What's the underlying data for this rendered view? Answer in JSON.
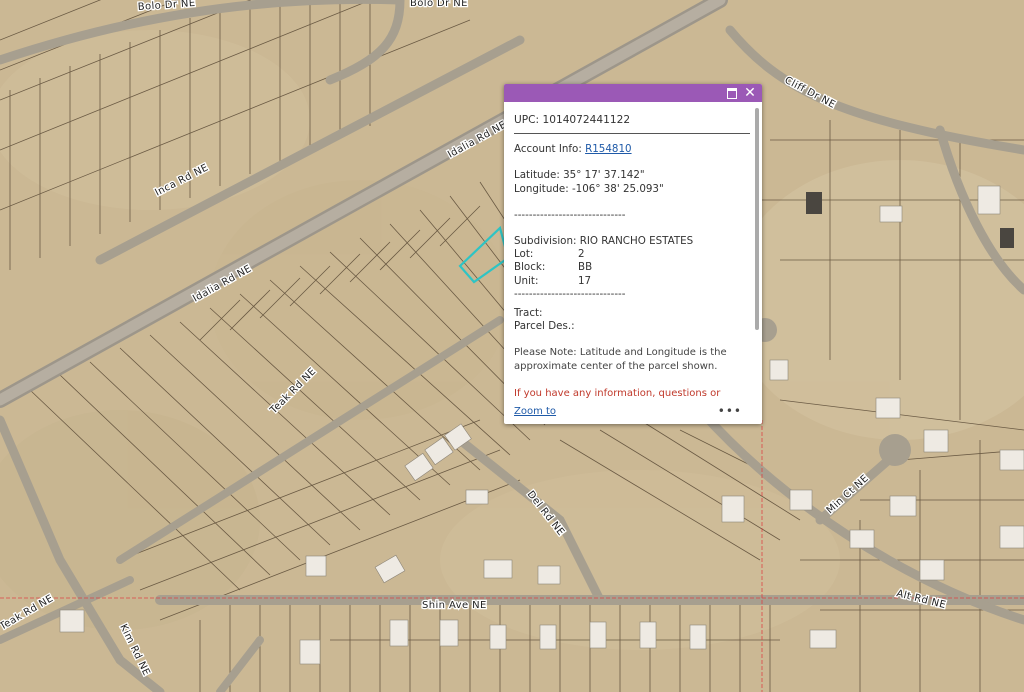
{
  "roads": {
    "bolo_dr_1": "Bolo Dr NE",
    "bolo_dr_2": "Bolo Dr NE",
    "inca_rd": "Inca Rd NE",
    "idalia_rd_upper": "Idalia Rd NE",
    "idalia_rd_lower": "Idalia Rd NE",
    "teak_rd_mid": "Teak Rd NE",
    "teak_rd_low": "Teak Rd NE",
    "cliff_dr": "Cliff Dr NE",
    "del_rd": "Del Rd NE",
    "min_ct": "Min Ct NE",
    "alt_rd": "Alt Rd NE",
    "shin_ave": "Shin Ave NE",
    "kim_rd": "Kim Rd NE"
  },
  "popup": {
    "upc": "UPC: 1014072441122",
    "account_label": "Account Info:",
    "account_link": "R154810",
    "latitude": "Latitude: 35° 17' 37.142\"",
    "longitude": "Longitude: -106° 38' 25.093\"",
    "divider": "------------------------------",
    "subdivision": "Subdivision: RIO RANCHO ESTATES",
    "lot_label": "Lot:",
    "lot_value": "2",
    "block_label": "Block:",
    "block_value": "BB",
    "unit_label": "Unit:",
    "unit_value": "17",
    "tract": "Tract:",
    "parcel_des": "Parcel Des.:",
    "note": "Please Note: Latitude and Longitude is the approximate center of the parcel shown.",
    "info": "If you have any information, questions or",
    "zoom_to": "Zoom to",
    "more": "•••",
    "close_icon": "✕"
  },
  "colors": {
    "popup_header": "#9b59b6",
    "parcel_highlight": "#2ec4c4",
    "terrain": "#cbb894",
    "road": "#a79f8f"
  }
}
